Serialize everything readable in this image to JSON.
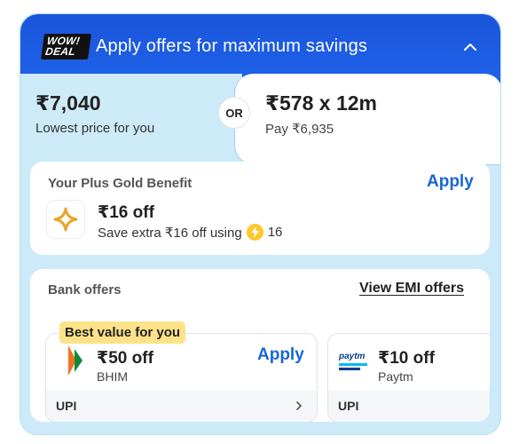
{
  "header": {
    "badge_line1": "WOW!",
    "badge_line2": "DEAL",
    "title": "Apply offers for maximum savings"
  },
  "price": {
    "amount": "₹7,040",
    "label": "Lowest price for you",
    "or": "OR",
    "emi_amount": "₹578 x 12m",
    "emi_label": "Pay ₹6,935"
  },
  "gold": {
    "title": "Your Plus Gold Benefit",
    "apply": "Apply",
    "amount": "₹16 off",
    "desc_prefix": "Save extra ₹16 off using",
    "coins": "16"
  },
  "bank": {
    "title": "Bank offers",
    "view_emi": "View EMI offers",
    "best_badge": "Best value for you",
    "offers": [
      {
        "amount": "₹50 off",
        "name": "BHIM",
        "apply": "Apply",
        "footer": "UPI",
        "icon": "bhim-logo-icon"
      },
      {
        "amount": "₹10 off",
        "name": "Paytm",
        "logo_text": "paytm",
        "footer": "UPI",
        "icon": "paytm-logo-icon"
      }
    ]
  },
  "colors": {
    "header_blue": "#1a55db",
    "card_bg": "#cdeaf8",
    "link_blue": "#1967d2",
    "badge_yellow": "#fde28a",
    "coin_yellow": "#ffc72c"
  }
}
